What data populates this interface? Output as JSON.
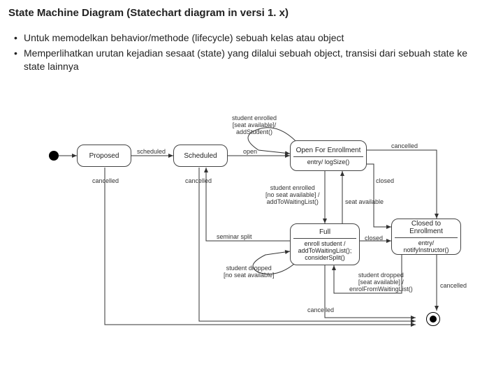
{
  "title": "State Machine Diagram (Statechart diagram in versi 1. x)",
  "bullets": [
    "Untuk memodelkan behavior/methode (lifecycle) sebuah kelas atau object",
    "Memperlihatkan urutan kejadian sesaat (state) yang dilalui sebuah object, transisi dari sebuah state ke state lainnya"
  ],
  "states": {
    "proposed": {
      "name": "Proposed"
    },
    "scheduled": {
      "name": "Scheduled"
    },
    "open": {
      "name": "Open For Enrollment",
      "entry": "entry/ logSize()"
    },
    "full": {
      "name": "Full",
      "entry": "enroll student /\naddToWaitingList();\nconsiderSplit()"
    },
    "closed": {
      "name": "Closed to Enrollment",
      "entry": "entry/ notifyInstructor()"
    }
  },
  "transitions": {
    "t_scheduled": "scheduled",
    "t_open": "open",
    "t_enrolled_seat": "student enrolled\n[seat available]/\naddStudent()",
    "t_enrolled_noseat": "student enrolled\n[no seat available] /\naddToWaitingList()",
    "t_seat_available": "seat available",
    "t_closed": "closed",
    "t_closed2": "closed",
    "t_cancelled": "cancelled",
    "t_cancelled2": "cancelled",
    "t_cancelled3": "cancelled",
    "t_cancelled4": "cancelled",
    "t_cancelled5": "cancelled",
    "t_seminar_split": "seminar split",
    "t_dropped_noseat": "student dropped\n[no seat available]",
    "t_dropped_seat": "student dropped\n[seat available] /\nenrolFromWaitingList()"
  }
}
